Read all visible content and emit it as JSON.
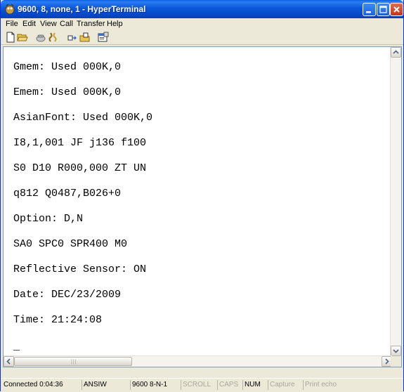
{
  "window": {
    "title": "9600, 8, none, 1 - HyperTerminal"
  },
  "menu": {
    "items": [
      {
        "label": "File"
      },
      {
        "label": "Edit"
      },
      {
        "label": "View"
      },
      {
        "label": "Call"
      },
      {
        "label": "Transfer"
      },
      {
        "label": "Help"
      }
    ]
  },
  "toolbar": {
    "icons": [
      "new-document-icon",
      "open-folder-icon",
      "call-icon",
      "disconnect-icon",
      "send-file-icon",
      "receive-file-icon",
      "properties-icon"
    ]
  },
  "terminal": {
    "lines": [
      "Gmem: Used 000K,0",
      "Emem: Used 000K,0",
      "AsianFont: Used 000K,0",
      "I8,1,001 JF j136 f100",
      "S0 D10 R000,000 ZT UN",
      "q812 Q0487,B026+0",
      "Option: D,N",
      "SA0 SPC0 SPR400 M0",
      "Reflective Sensor: ON",
      "Date: DEC/23/2009",
      "Time: 21:24:08",
      "_"
    ]
  },
  "status": {
    "connected": "Connected 0:04:36",
    "emulation": "ANSIW",
    "settings": "9600 8-N-1",
    "scroll": "SCROLL",
    "caps": "CAPS",
    "num": "NUM",
    "capture": "Capture",
    "print_echo": "Print echo"
  }
}
